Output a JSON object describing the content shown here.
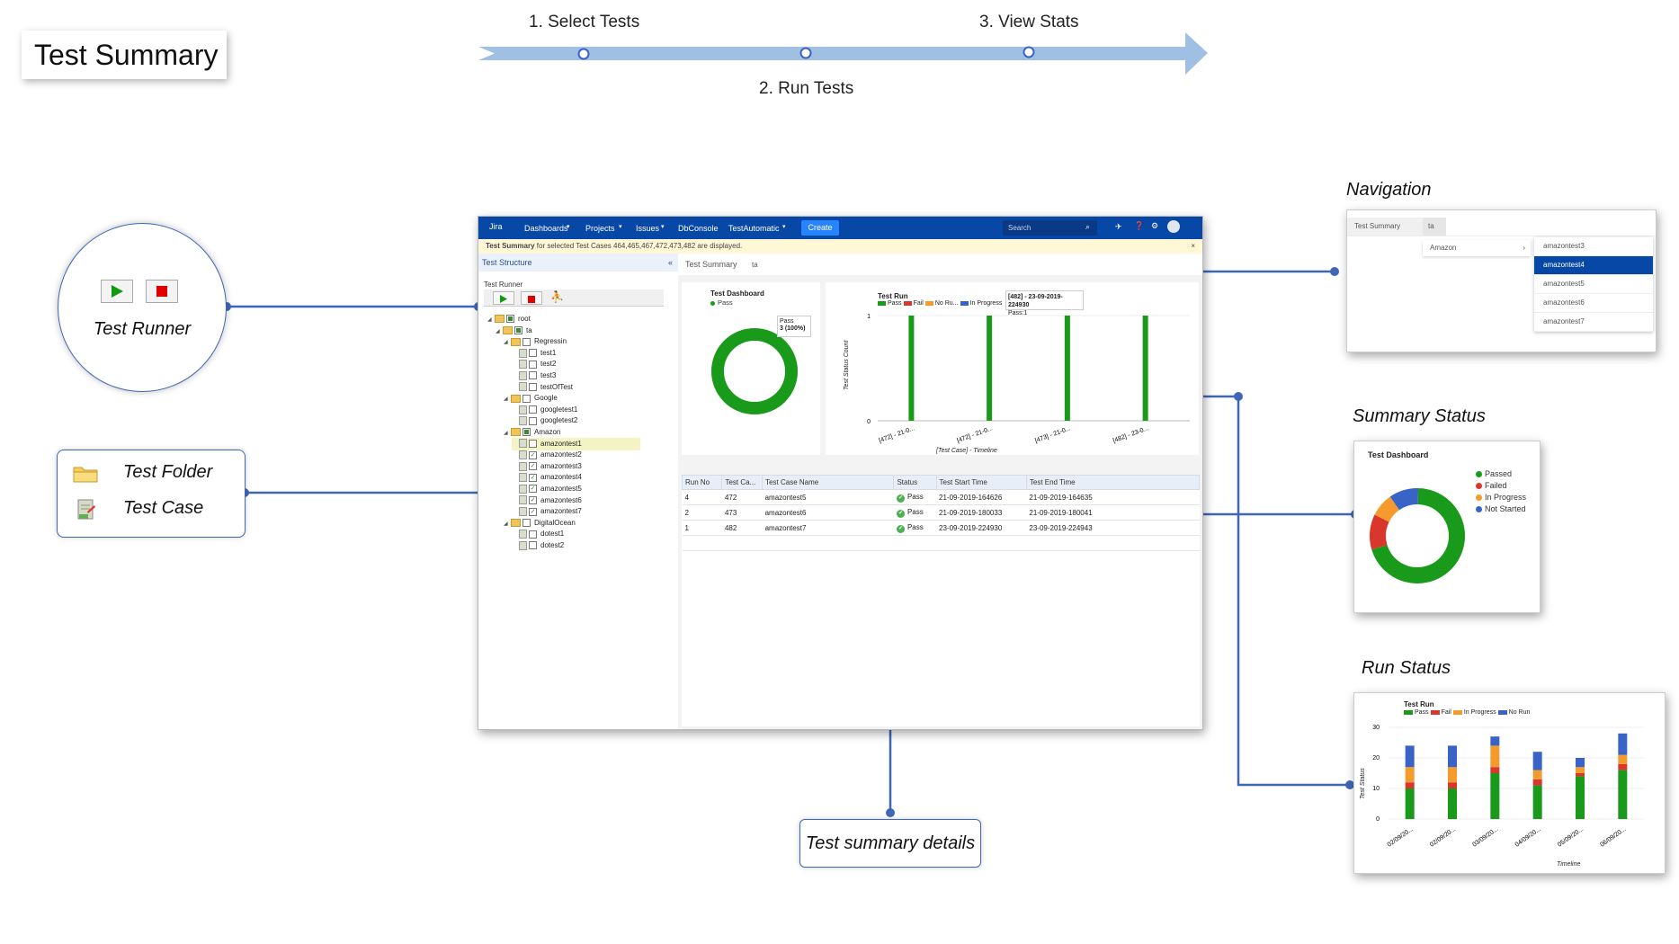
{
  "title": "Test Summary",
  "steps": [
    "1. Select Tests",
    "2. Run Tests",
    "3. View Stats"
  ],
  "callouts": {
    "test_runner": "Test Runner",
    "test_folder": "Test Folder",
    "test_case": "Test Case",
    "navigation": "Navigation",
    "summary_status": "Summary Status",
    "run_status": "Run Status",
    "test_summary_details": "Test summary details"
  },
  "jira": {
    "logo": "Jira",
    "nav": [
      "Dashboards",
      "Projects",
      "Issues",
      "DbConsole",
      "TestAutomatic"
    ],
    "create": "Create",
    "search_placeholder": "Search",
    "banner_bold": "Test Summary",
    "banner_rest": "for selected Test Cases 464,465,467,472,473,482 are displayed.",
    "banner_close": "×",
    "tree_title": "Test Structure",
    "runner_title": "Test Runner",
    "tree": [
      "root",
      "ta",
      "Regressin",
      "test1",
      "test2",
      "test3",
      "testOfTest",
      "Google",
      "googletest1",
      "googletest2",
      "Amazon",
      "amazontest1",
      "amazontest2",
      "amazontest3",
      "amazontest4",
      "amazontest5",
      "amazontest6",
      "amazontest7",
      "DigitalOcean",
      "dotest1",
      "dotest2"
    ],
    "crumb": [
      "Test Summary",
      "ta"
    ],
    "dashboard": {
      "title": "Test Dashboard",
      "legend": "Pass",
      "tooltip_l1": "Pass",
      "tooltip_l2": "3 (100%)"
    },
    "testrun": {
      "title": "Test Run",
      "legend": [
        "Pass",
        "Fail",
        "No Ru...",
        "In Progress"
      ],
      "ylabel": "Test Status Count",
      "xlabel": "[Test Case] - Timeline",
      "yticks": [
        "1",
        "0"
      ],
      "xticks": [
        "[472] - 21-0...",
        "[472] - 21-0...",
        "[473] - 21-0...",
        "[482] - 23-0..."
      ],
      "tooltip_l1": "[482] - 23-09-2019-224930",
      "tooltip_l2": "Pass:1"
    },
    "table": {
      "headers": [
        "Run No",
        "Test Ca...",
        "Test Case Name",
        "Status",
        "Test Start Time",
        "Test End Time"
      ],
      "rows": [
        [
          "4",
          "472",
          "amazontest5",
          "Pass",
          "21-09-2019-164626",
          "21-09-2019-164635"
        ],
        [
          "2",
          "473",
          "amazontest6",
          "Pass",
          "21-09-2019-180033",
          "21-09-2019-180041"
        ],
        [
          "1",
          "482",
          "amazontest7",
          "Pass",
          "23-09-2019-224930",
          "23-09-2019-224943"
        ]
      ]
    }
  },
  "nav_shot": {
    "crumb": [
      "Test Summary",
      "ta"
    ],
    "menu": "Amazon",
    "submenu": [
      "amazontest3",
      "amazontest4",
      "amazontest5",
      "amazontest6",
      "amazontest7"
    ],
    "selected": "amazontest4"
  },
  "summary_shot": {
    "title": "Test Dashboard",
    "legend": [
      "Passed",
      "Failed",
      "In Progress",
      "Not Started"
    ]
  },
  "run_shot": {
    "title": "Test Run",
    "legend": [
      "Pass",
      "Fail",
      "In Progress",
      "No Run"
    ],
    "ylabel": "Test Status",
    "xlabel": "Timeline",
    "yticks": [
      "30",
      "20",
      "10",
      "0"
    ],
    "xticks": [
      "02/09/20...",
      "02/09/20...",
      "03/09/20...",
      "04/09/20...",
      "05/09/20...",
      "06/09/20..."
    ]
  },
  "chart_data": [
    {
      "type": "pie",
      "title": "Test Dashboard",
      "categories": [
        "Pass"
      ],
      "values": [
        3
      ]
    },
    {
      "type": "bar",
      "title": "Test Run",
      "xlabel": "[Test Case] - Timeline",
      "ylabel": "Test Status Count",
      "categories": [
        "[472] - 21-0...",
        "[472] - 21-0...",
        "[473] - 21-0...",
        "[482] - 23-0..."
      ],
      "series": [
        {
          "name": "Pass",
          "values": [
            1,
            1,
            1,
            1
          ]
        }
      ],
      "ylim": [
        0,
        1
      ]
    },
    {
      "type": "pie",
      "title": "Test Dashboard",
      "categories": [
        "Passed",
        "Failed",
        "In Progress",
        "Not Started"
      ],
      "values": [
        70,
        12,
        8,
        10
      ]
    },
    {
      "type": "bar",
      "title": "Test Run",
      "xlabel": "Timeline",
      "ylabel": "Test Status",
      "categories": [
        "02/09/20...",
        "02/09/20...",
        "03/09/20...",
        "04/09/20...",
        "05/09/20...",
        "06/09/20..."
      ],
      "series": [
        {
          "name": "Pass",
          "values": [
            10,
            10,
            15,
            11,
            14,
            16
          ]
        },
        {
          "name": "Fail",
          "values": [
            2,
            2,
            2,
            2,
            1,
            2
          ]
        },
        {
          "name": "In Progress",
          "values": [
            5,
            5,
            7,
            3,
            2,
            3
          ]
        },
        {
          "name": "No Run",
          "values": [
            7,
            7,
            3,
            6,
            3,
            7
          ]
        }
      ],
      "ylim": [
        0,
        30
      ]
    }
  ],
  "colors": {
    "pass": "#1a9a1a",
    "fail": "#d9372b",
    "in_progress": "#f59a2c",
    "no_run": "#3a63c8",
    "jira_blue": "#0747a6",
    "connector": "#3f67b5",
    "arrow": "#9fbfe3"
  }
}
